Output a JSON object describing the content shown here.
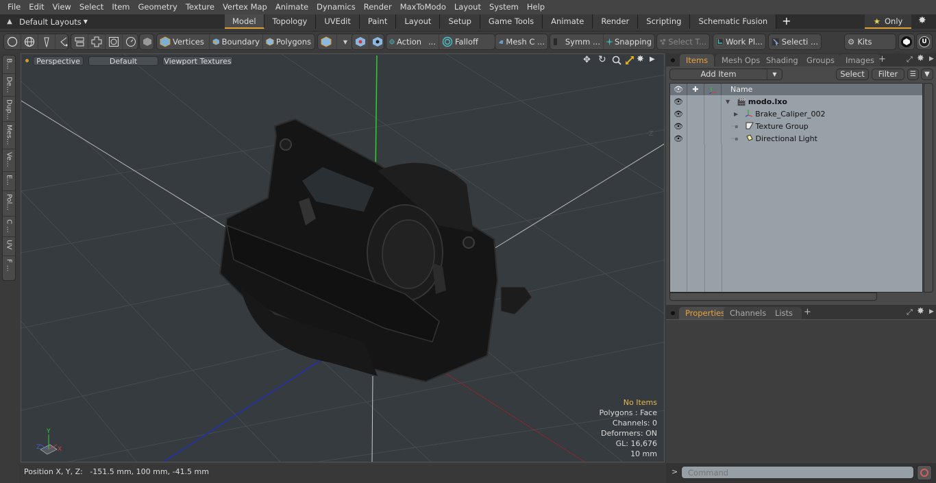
{
  "menubar": {
    "items": [
      "File",
      "Edit",
      "View",
      "Select",
      "Item",
      "Geometry",
      "Texture",
      "Vertex Map",
      "Animate",
      "Dynamics",
      "Render",
      "MaxToModo",
      "Layout",
      "System",
      "Help"
    ]
  },
  "layoutbar": {
    "layouts_label": "Default Layouts",
    "tabs": [
      "Model",
      "Topology",
      "UVEdit",
      "Paint",
      "Layout",
      "Setup",
      "Game Tools",
      "Animate",
      "Render",
      "Scripting",
      "Schematic Fusion"
    ],
    "active_tab": "Model",
    "add_label": "+",
    "only_label": "Only"
  },
  "toolbar": {
    "vertices": "Vertices",
    "boundary": "Boundary",
    "polygons": "Polygons",
    "action": "Action",
    "action_more": "...",
    "falloff": "Falloff",
    "mesh_c": "Mesh C ...",
    "symm": "Symm ...",
    "snapping": "Snapping",
    "select_t": "Select T...",
    "work_pl": "Work Pl...",
    "selecti": "Selecti ...",
    "kits": "Kits"
  },
  "left_palette": {
    "tabs": [
      "B...",
      "De...",
      "Dup...",
      "Mes...",
      "Ve...",
      "E...",
      "Pol...",
      "C ...",
      "UV",
      "F ..."
    ]
  },
  "viewport": {
    "perspective": "Perspective",
    "default": "Default",
    "textures": "Viewport Textures",
    "axis_label_z": "-Z",
    "hud": {
      "selection": "No Items",
      "polygons": "Polygons : Face",
      "channels": "Channels: 0",
      "deformers": "Deformers: ON",
      "gl": "GL: 16,676",
      "units": "10 mm"
    },
    "gizmo": {
      "x": "X",
      "y": "Y",
      "z": "Z"
    }
  },
  "statusbar": {
    "position": "Position X, Y, Z:   -151.5 mm, 100 mm, -41.5 mm"
  },
  "items_panel": {
    "tabs": [
      "Items",
      "Mesh Ops",
      "Shading",
      "Groups",
      "Images"
    ],
    "active_tab": "Items",
    "add_item": "Add Item",
    "select": "Select",
    "filter": "Filter",
    "column_name": "Name",
    "rows": [
      {
        "name": "modo.lxo",
        "icon": "scene-icon",
        "bold": true
      },
      {
        "name": "Brake_Caliper_002",
        "icon": "mesh-locator-icon"
      },
      {
        "name": "Texture Group",
        "icon": "texture-group-icon"
      },
      {
        "name": "Directional Light",
        "icon": "light-icon"
      }
    ]
  },
  "properties_panel": {
    "tabs": [
      "Properties",
      "Channels",
      "Lists"
    ],
    "active_tab": "Properties"
  },
  "command": {
    "placeholder": "Command",
    "prompt": ">"
  },
  "colors": {
    "accent": "#e0a030",
    "tree_bg": "#98a0a8",
    "viewport_bg": "#363b3f"
  }
}
